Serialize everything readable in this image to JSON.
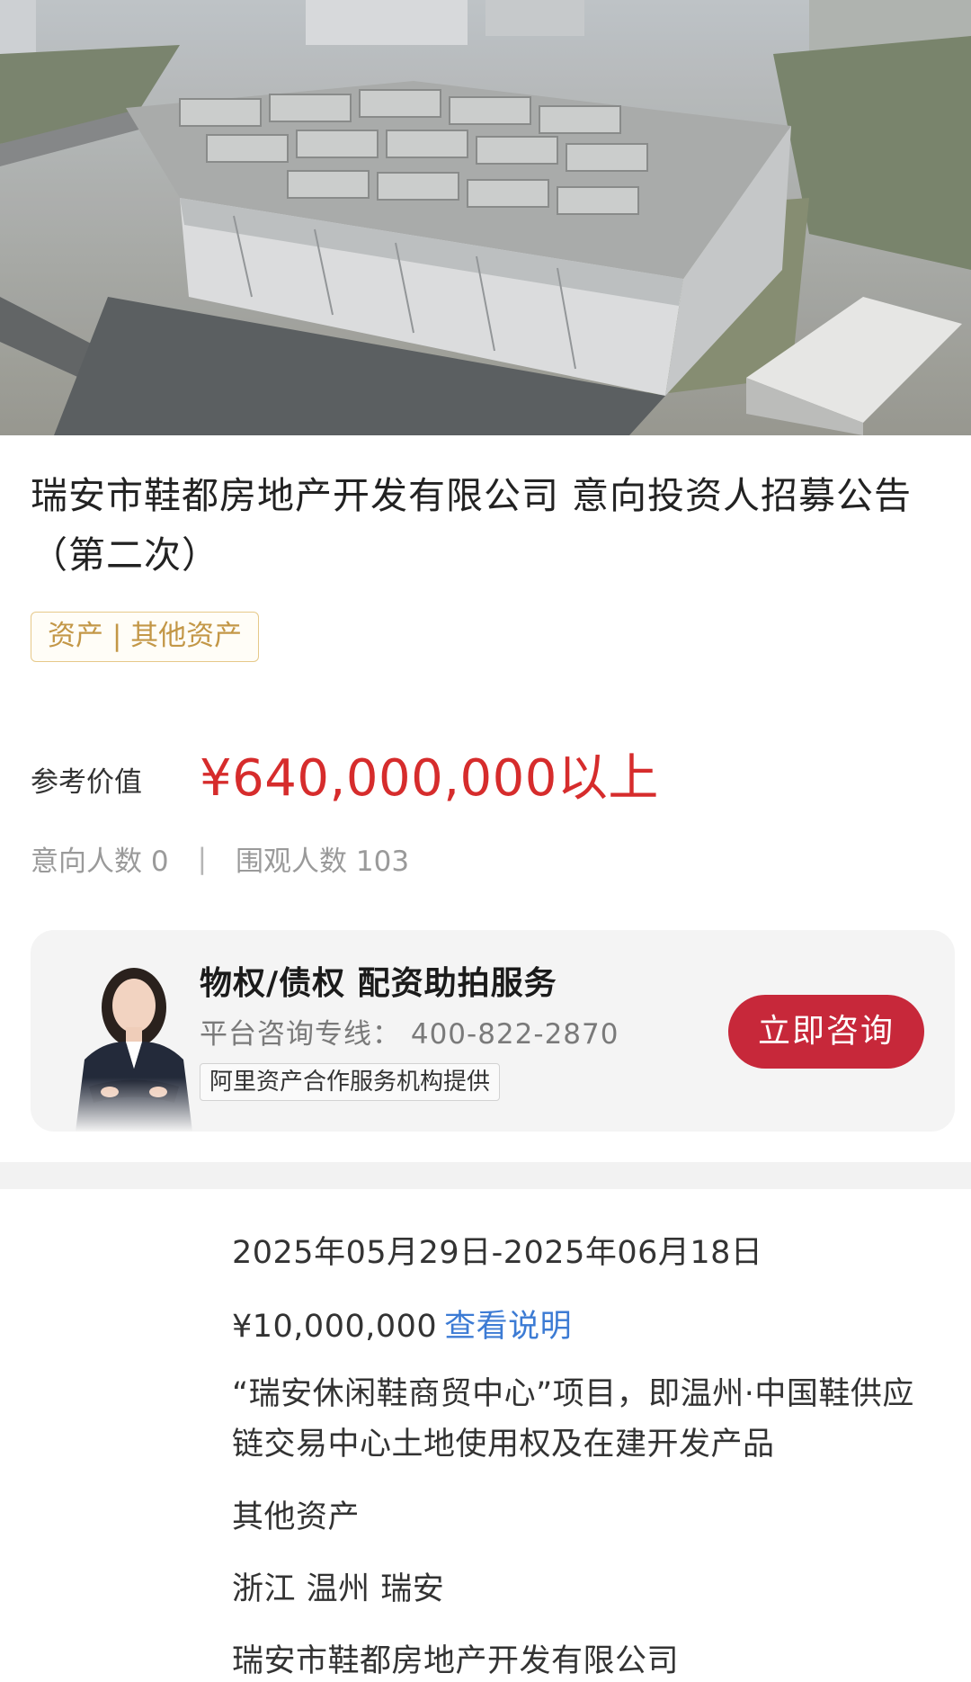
{
  "listing": {
    "title": "瑞安市鞋都房地产开发有限公司 意向投资人招募公告（第二次）",
    "tag": "资产 | 其他资产",
    "reference_label": "参考价值",
    "reference_value": "¥640,000,000以上",
    "interested_label": "意向人数 0",
    "separator": "|",
    "viewers_label": "围观人数 103"
  },
  "consult_card": {
    "title": "物权/债权  配资助拍服务",
    "phone_line": "平台咨询专线： 400-822-2870",
    "provider": "阿里资产合作服务机构提供",
    "button_label": "立即咨询"
  },
  "details": {
    "date_range": "2025年05月29日-2025年06月18日",
    "deposit": "¥10,000,000",
    "deposit_link": "查看说明",
    "description": "“瑞安休闲鞋商贸中心”项目，即温州·中国鞋供应链交易中心土地使用权及在建开发产品",
    "asset_type": "其他资产",
    "location": "浙江 温州 瑞安",
    "organization": "瑞安市鞋都房地产开发有限公司"
  },
  "colors": {
    "price_red": "#d62c2c",
    "button_red": "#c7283a",
    "tag_gold": "#c39747",
    "link_blue": "#3c7bd4"
  }
}
